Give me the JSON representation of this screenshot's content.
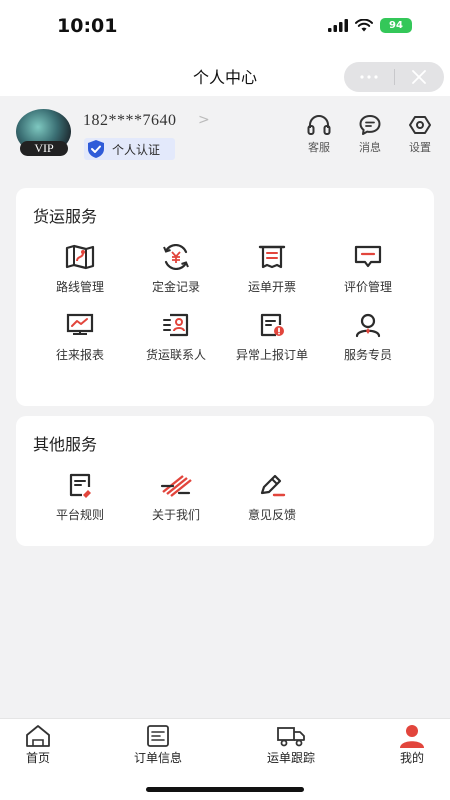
{
  "status_bar": {
    "time": "10:01",
    "battery": "94"
  },
  "nav": {
    "title": "个人中心"
  },
  "profile": {
    "badge": "VIP",
    "phone": "182****7640",
    "arrow": ">",
    "certification": "个人认证",
    "tools": [
      {
        "label": "客服",
        "icon": "headset-icon"
      },
      {
        "label": "消息",
        "icon": "message-icon"
      },
      {
        "label": "设置",
        "icon": "settings-icon"
      }
    ]
  },
  "freight_services": {
    "title": "货运服务",
    "items": [
      {
        "label": "路线管理",
        "icon": "route-map-icon"
      },
      {
        "label": "定金记录",
        "icon": "deposit-yuan-icon"
      },
      {
        "label": "运单开票",
        "icon": "invoice-printer-icon"
      },
      {
        "label": "评价管理",
        "icon": "review-comment-icon"
      },
      {
        "label": "往来报表",
        "icon": "report-chart-icon"
      },
      {
        "label": "货运联系人",
        "icon": "contact-card-icon"
      },
      {
        "label": "异常上报订单",
        "icon": "exception-report-icon"
      },
      {
        "label": "服务专员",
        "icon": "service-agent-icon"
      }
    ]
  },
  "other_services": {
    "title": "其他服务",
    "items": [
      {
        "label": "平台规则",
        "icon": "rules-document-icon"
      },
      {
        "label": "关于我们",
        "icon": "about-stripes-icon"
      },
      {
        "label": "意见反馈",
        "icon": "feedback-pen-icon"
      }
    ]
  },
  "tabbar": {
    "items": [
      {
        "label": "首页",
        "icon": "home-icon"
      },
      {
        "label": "订单信息",
        "icon": "order-info-icon"
      },
      {
        "label": "运单跟踪",
        "icon": "truck-icon"
      },
      {
        "label": "我的",
        "icon": "person-icon",
        "active": true
      }
    ]
  },
  "colors": {
    "accent_red": "#e2453c",
    "cert_blue": "#2f5bd8",
    "background": "#f2f2f3"
  }
}
